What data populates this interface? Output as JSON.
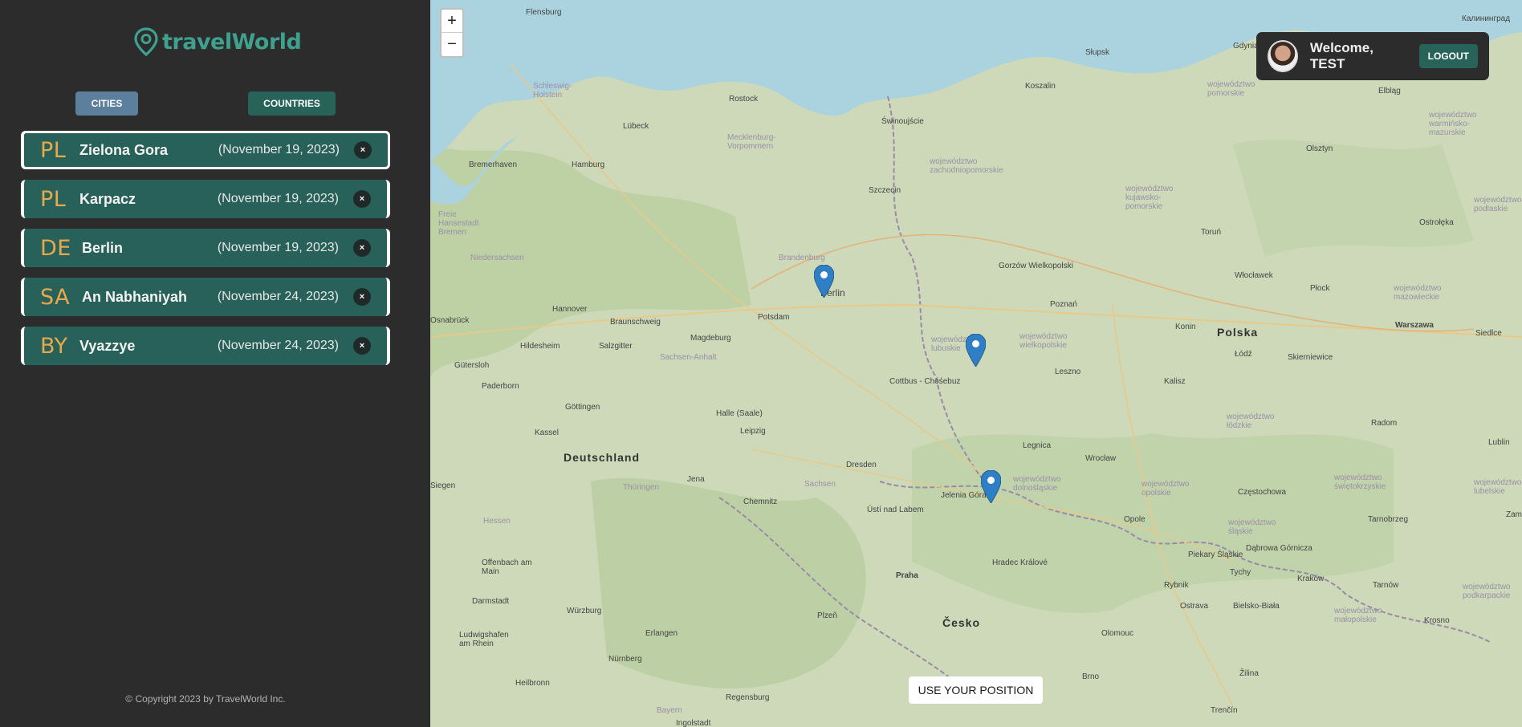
{
  "app": {
    "logo_text": "travelWorld"
  },
  "tabs": {
    "cities_label": "CITIES",
    "countries_label": "COUNTRIES"
  },
  "cities": [
    {
      "code": "PL",
      "name": "Zielona Gora",
      "date": "(November 19, 2023)",
      "active": true
    },
    {
      "code": "PL",
      "name": "Karpacz",
      "date": "(November 19, 2023)",
      "active": false
    },
    {
      "code": "DE",
      "name": "Berlin",
      "date": "(November 19, 2023)",
      "active": false
    },
    {
      "code": "SA",
      "name": "An Nabhaniyah",
      "date": "(November 24, 2023)",
      "active": false
    },
    {
      "code": "BY",
      "name": "Vyazzye",
      "date": "(November 24, 2023)",
      "active": false
    }
  ],
  "remove_glyph": "×",
  "footer": {
    "copyright": "© Copyright 2023 by TravelWorld Inc."
  },
  "map": {
    "zoom_in": "+",
    "zoom_out": "−",
    "use_position_label": "USE YOUR POSITION",
    "labels": {
      "flensburg": "Flensburg",
      "slupsk": "Słupsk",
      "gdynia": "Gdynia",
      "kaliningrad": "Калининград",
      "schleswig": "Schleswig-Holstein",
      "rostock": "Rostock",
      "koszalin": "Koszalin",
      "pomorskie": "województwo pomorskie",
      "elblag": "Elbląg",
      "lubeck": "Lübeck",
      "swinoujscie": "Świnoujście",
      "mecklenburg": "Mecklenburg-Vorpommern",
      "warminsko": "województwo warmińsko-mazurskie",
      "bremerhaven": "Bremerhaven",
      "hamburg": "Hamburg",
      "olsztyn": "Olsztyn",
      "zachodniopomorskie": "województwo zachodniopomorskie",
      "szczecin": "Szczecin",
      "bremen": "Freie Hansestadt Bremen",
      "kujawsko": "województwo kujawsko-pomorskie",
      "torun": "Toruń",
      "ostroleka": "Ostrołęka",
      "podlaskie": "województwo podlaskie",
      "niedersachsen": "Niedersachsen",
      "brandenburg": "Brandenburg",
      "gorzow": "Gorzów Wielkopolski",
      "wloclawek": "Włocławek",
      "plock": "Płock",
      "mazowieckie": "województwo mazowieckie",
      "berlin": "Berlin",
      "hannover": "Hannover",
      "braunschweig": "Braunschweig",
      "potsdam": "Potsdam",
      "poznan": "Poznań",
      "konin": "Konin",
      "polska": "Polska",
      "warszawa": "Warszawa",
      "siedlce": "Siedlce",
      "osnabruck": "Osnabrück",
      "hildesheim": "Hildesheim",
      "salzgitter": "Salzgitter",
      "magdeburg": "Magdeburg",
      "lubuskie": "województwo lubuskie",
      "wielkopolskie": "województwo wielkopolskie",
      "skierniewice": "Skierniewice",
      "gutersloh": "Gütersloh",
      "sachsen_anhalt": "Sachsen-Anhalt",
      "leszno": "Leszno",
      "paderborn": "Paderborn",
      "cottbus": "Cottbus - Chóśebuz",
      "kalisz": "Kalisz",
      "lodz": "Łódź",
      "gottingen": "Göttingen",
      "halle": "Halle (Saale)",
      "lodzkie": "województwo łódzkie",
      "radom": "Radom",
      "kassel": "Kassel",
      "leipzig": "Leipzig",
      "lublin": "Lublin",
      "legnica": "Legnica",
      "deutschland": "Deutschland",
      "wroclaw": "Wrocław",
      "dresden": "Dresden",
      "jena": "Jena",
      "thuringen": "Thüringen",
      "sachsen": "Sachsen",
      "dolnoslaskie": "województwo dolnośląskie",
      "opolskie": "województwo opolskie",
      "swietokrzyskie": "województwo świętokrzyskie",
      "lubelskie": "województwo lubelskie",
      "siegen": "Siegen",
      "czestochowa": "Częstochowa",
      "chemnitz": "Chemnitz",
      "jelenia": "Jelenia Góra",
      "usti": "Ústí nad Labem",
      "opole": "Opole",
      "hessen": "Hessen",
      "slaskie": "województwo śląskie",
      "tarnobrzeg": "Tarnobrzeg",
      "zamosc": "Zam",
      "piekary": "Piekary Śląskie",
      "dabrowa": "Dąbrowa Górnicza",
      "offenbach": "Offenbach am Main",
      "hradec": "Hradec Králové",
      "tychy": "Tychy",
      "praha": "Praha",
      "krakow": "Kraków",
      "rybnik": "Rybnik",
      "tarnow": "Tarnów",
      "darmstadt": "Darmstadt",
      "podkarpackie": "województwo podkarpackie",
      "wurzburg": "Würzburg",
      "ostrava": "Ostrava",
      "bielsko": "Bielsko-Biała",
      "plzen": "Plzeň",
      "cesko": "Česko",
      "malopolskie": "województwo małopolskie",
      "krosno": "Krosno",
      "erlangen": "Erlangen",
      "olomouc": "Olomouc",
      "ludwigshafen": "Ludwigshafen am Rhein",
      "nurnberg": "Nürnberg",
      "zilina": "Žilina",
      "heilbronn": "Heilbronn",
      "brno": "Brno",
      "regensburg": "Regensburg",
      "bayern": "Bayern",
      "ingolstadt": "Ingolstadt",
      "trencin": "Trenčín"
    }
  },
  "user": {
    "welcome": "Welcome, TEST",
    "logout_label": "LOGOUT"
  }
}
